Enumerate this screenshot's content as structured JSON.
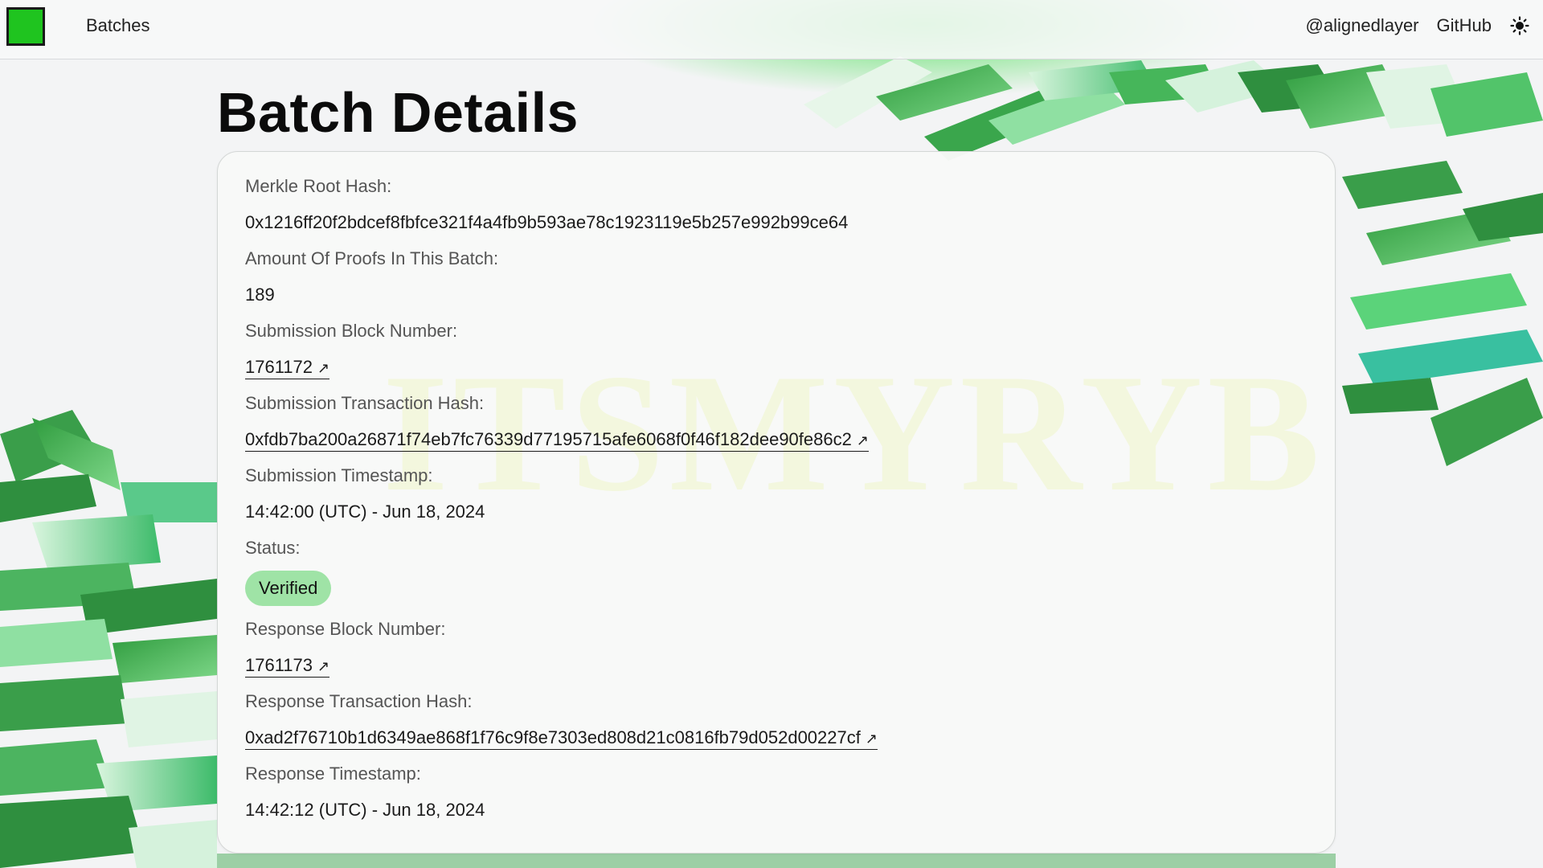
{
  "nav": {
    "batches_label": "Batches",
    "twitter_label": "@alignedlayer",
    "github_label": "GitHub",
    "theme_icon": "sun-icon"
  },
  "brand": {
    "logo_color": "#1fc41f"
  },
  "page": {
    "title": "Batch Details"
  },
  "watermark": "ITSMYRYB",
  "details": {
    "merkle_root": {
      "label": "Merkle Root Hash:",
      "value": "0x1216ff20f2bdcef8fbfce321f4a4fb9b593ae78c1923119e5b257e992b99ce64"
    },
    "amount_of_proofs": {
      "label": "Amount Of Proofs In This Batch:",
      "value": "189"
    },
    "submission_block": {
      "label": "Submission Block Number:",
      "value": "1761172"
    },
    "submission_tx": {
      "label": "Submission Transaction Hash:",
      "value": "0xfdb7ba200a26871f74eb7fc76339d77195715afe6068f0f46f182dee90fe86c2"
    },
    "submission_timestamp": {
      "label": "Submission Timestamp:",
      "value": "14:42:00 (UTC) - Jun 18, 2024"
    },
    "status": {
      "label": "Status:",
      "value": "Verified",
      "color": "#9fe3a6"
    },
    "response_block": {
      "label": "Response Block Number:",
      "value": "1761173"
    },
    "response_tx": {
      "label": "Response Transaction Hash:",
      "value": "0xad2f76710b1d6349ae868f1f76c9f8e7303ed808d21c0816fb79d052d00227cf"
    },
    "response_timestamp": {
      "label": "Response Timestamp:",
      "value": "14:42:12 (UTC) - Jun 18, 2024"
    }
  },
  "external_link_glyph": "↗"
}
